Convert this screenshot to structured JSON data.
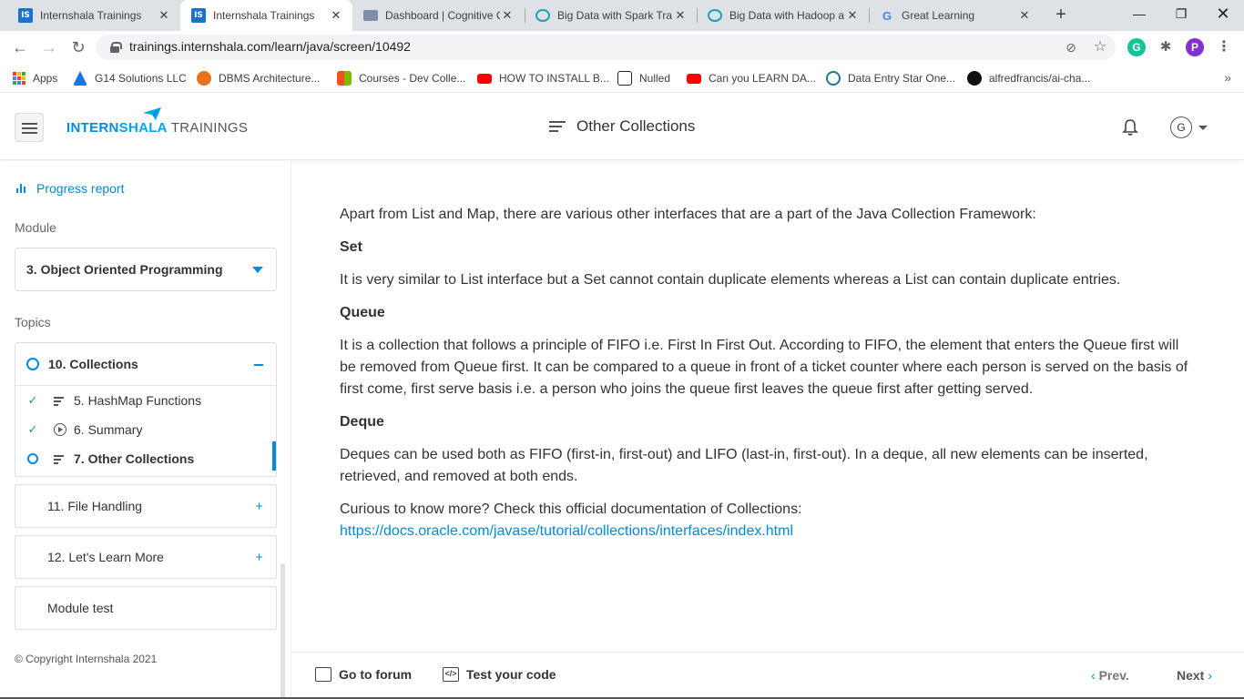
{
  "browser": {
    "tabs": [
      {
        "title": "Internshala Trainings",
        "icon": "internshala-favicon",
        "active": false
      },
      {
        "title": "Internshala Trainings",
        "icon": "internshala-favicon",
        "active": true
      },
      {
        "title": "Dashboard | Cognitive C",
        "icon": "dashboard-favicon",
        "active": false
      },
      {
        "title": "Big Data with Spark Tra",
        "icon": "cloud-favicon",
        "active": false
      },
      {
        "title": "Big Data with Hadoop a",
        "icon": "cloud-favicon",
        "active": false
      },
      {
        "title": "Great Learning",
        "icon": "google-favicon",
        "active": false
      }
    ],
    "url": "trainings.internshala.com/learn/java/screen/10492",
    "profile_initial": "P",
    "bookmarks": [
      {
        "label": "Apps",
        "color": "#4285f4"
      },
      {
        "label": "G14 Solutions LLC",
        "color": "#1a73e8"
      },
      {
        "label": "DBMS Architecture...",
        "color": "#e8711a"
      },
      {
        "label": "Courses - Dev Colle...",
        "color": "#f25022"
      },
      {
        "label": "HOW TO INSTALL B...",
        "color": "#ff0000"
      },
      {
        "label": "Nulled",
        "color": "#222222"
      },
      {
        "label": "Can you LEARN DA...",
        "color": "#ff0000"
      },
      {
        "label": "Data Entry Star One...",
        "color": "#21759b"
      },
      {
        "label": "alfredfrancis/ai-cha...",
        "color": "#111111"
      }
    ]
  },
  "header": {
    "logo_brand_a": "INTERN",
    "logo_brand_b": "SHALA",
    "logo_sub": "TRAININGS",
    "title": "Other Collections",
    "avatar_initial": "G"
  },
  "sidebar": {
    "progress_label": "Progress report",
    "module_label": "Module",
    "module_value": "3. Object Oriented Programming",
    "topics_label": "Topics",
    "open_topic": "10. Collections",
    "sub_items": [
      {
        "label": "5. HashMap Functions",
        "done": true,
        "kind": "text"
      },
      {
        "label": "6. Summary",
        "done": true,
        "kind": "video"
      },
      {
        "label": "7. Other Collections",
        "done": false,
        "kind": "text",
        "active": true
      }
    ],
    "collapsed_topics": [
      "11. File Handling",
      "12. Let's Learn More",
      "Module test"
    ],
    "copyright": "© Copyright Internshala 2021"
  },
  "content": {
    "intro": "Apart from List and Map, there are various other interfaces that are a part of the Java Collection Framework:",
    "set_heading": "Set",
    "set_text": "It is very similar to List interface but a Set cannot contain duplicate elements whereas a List can contain duplicate entries.",
    "queue_heading": "Queue",
    "queue_text": "It is a collection that follows a principle of FIFO i.e. First In First Out. According to FIFO, the element that enters the Queue first will be removed from Queue first. It can be compared to a queue in front of a ticket counter where each person is served on the basis of first come, first serve basis i.e. a person who joins the queue first leaves the queue first after getting served.",
    "deque_heading": "Deque",
    "deque_text": "Deques can be used both as FIFO (first-in, first-out) and LIFO (last-in, first-out). In a deque, all new elements can be inserted, retrieved, and removed at both ends.",
    "curious_text": "Curious to know more? Check this official documentation of Collections:",
    "doc_link": "https://docs.oracle.com/javase/tutorial/collections/interfaces/index.html"
  },
  "footer": {
    "forum_label": "Go to forum",
    "test_label": "Test your code",
    "prev_label": "Prev.",
    "next_label": "Next"
  },
  "colors": {
    "accent": "#008bdc",
    "done_check": "#1aa15f"
  }
}
